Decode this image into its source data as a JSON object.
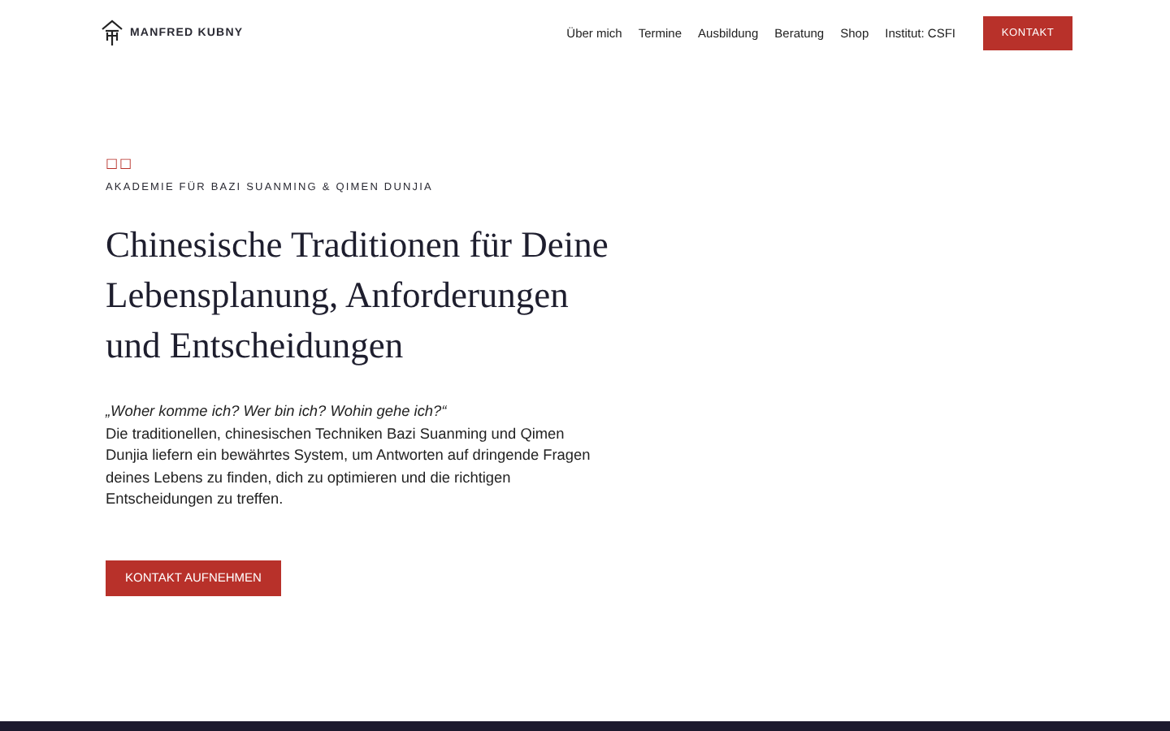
{
  "brand": {
    "name": "MANFRED KUBNY"
  },
  "nav": {
    "items": [
      "Über mich",
      "Termine",
      "Ausbildung",
      "Beratung",
      "Shop",
      "Institut: CSFI"
    ],
    "cta": "KONTAKT"
  },
  "hero": {
    "glyphs": "□□",
    "eyebrow": "AKADEMIE FÜR BAZI SUANMING & QIMEN DUNJIA",
    "title": "Chinesische Traditionen für Deine Lebensplanung, Anforderungen und Entscheidungen",
    "quote": "„Woher komme ich? Wer bin ich? Wohin gehe ich?“",
    "body": "Die traditionellen, chinesischen Techniken Bazi Suanming und Qimen Dunjia liefern ein bewährtes System, um Antworten auf dringende Fragen deines Lebens zu finden, dich zu optimieren und die richtigen Entscheidungen zu treffen.",
    "button": "KONTAKT AUFNEHMEN"
  }
}
